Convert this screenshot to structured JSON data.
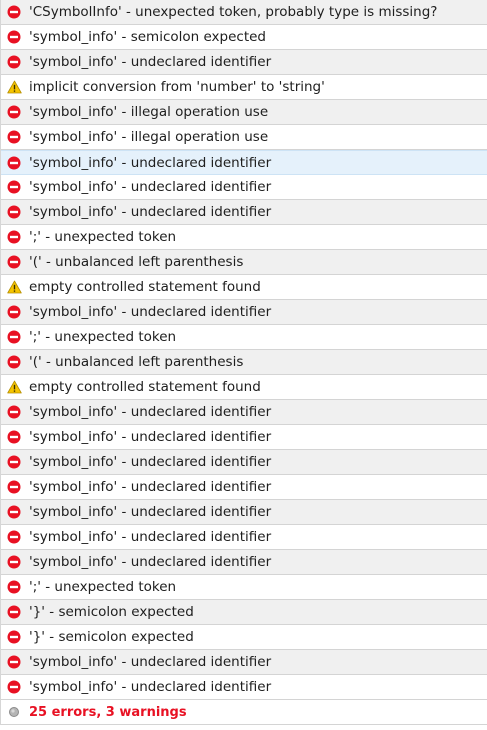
{
  "messages": [
    {
      "type": "error",
      "icon": "error-icon",
      "text": "'CSymbolInfo' - unexpected token, probably type is missing?"
    },
    {
      "type": "error",
      "icon": "error-icon",
      "text": "'symbol_info' - semicolon expected"
    },
    {
      "type": "error",
      "icon": "error-icon",
      "text": "'symbol_info' - undeclared identifier"
    },
    {
      "type": "warning",
      "icon": "warning-icon",
      "text": "implicit conversion from 'number' to 'string'"
    },
    {
      "type": "error",
      "icon": "error-icon",
      "text": "'symbol_info' - illegal operation use"
    },
    {
      "type": "error",
      "icon": "error-icon",
      "text": "'symbol_info' - illegal operation use"
    },
    {
      "type": "error",
      "icon": "error-icon",
      "text": "'symbol_info' - undeclared identifier",
      "selected": true
    },
    {
      "type": "error",
      "icon": "error-icon",
      "text": "'symbol_info' - undeclared identifier"
    },
    {
      "type": "error",
      "icon": "error-icon",
      "text": "'symbol_info' - undeclared identifier"
    },
    {
      "type": "error",
      "icon": "error-icon",
      "text": "';' - unexpected token"
    },
    {
      "type": "error",
      "icon": "error-icon",
      "text": "'(' - unbalanced left parenthesis"
    },
    {
      "type": "warning",
      "icon": "warning-icon",
      "text": "empty controlled statement found"
    },
    {
      "type": "error",
      "icon": "error-icon",
      "text": "'symbol_info' - undeclared identifier"
    },
    {
      "type": "error",
      "icon": "error-icon",
      "text": "';' - unexpected token"
    },
    {
      "type": "error",
      "icon": "error-icon",
      "text": "'(' - unbalanced left parenthesis"
    },
    {
      "type": "warning",
      "icon": "warning-icon",
      "text": "empty controlled statement found"
    },
    {
      "type": "error",
      "icon": "error-icon",
      "text": "'symbol_info' - undeclared identifier"
    },
    {
      "type": "error",
      "icon": "error-icon",
      "text": "'symbol_info' - undeclared identifier"
    },
    {
      "type": "error",
      "icon": "error-icon",
      "text": "'symbol_info' - undeclared identifier"
    },
    {
      "type": "error",
      "icon": "error-icon",
      "text": "'symbol_info' - undeclared identifier"
    },
    {
      "type": "error",
      "icon": "error-icon",
      "text": "'symbol_info' - undeclared identifier"
    },
    {
      "type": "error",
      "icon": "error-icon",
      "text": "'symbol_info' - undeclared identifier"
    },
    {
      "type": "error",
      "icon": "error-icon",
      "text": "'symbol_info' - undeclared identifier"
    },
    {
      "type": "error",
      "icon": "error-icon",
      "text": "';' - unexpected token"
    },
    {
      "type": "error",
      "icon": "error-icon",
      "text": "'}' - semicolon expected"
    },
    {
      "type": "error",
      "icon": "error-icon",
      "text": "'}' - semicolon expected"
    },
    {
      "type": "error",
      "icon": "error-icon",
      "text": "'symbol_info' - undeclared identifier"
    },
    {
      "type": "error",
      "icon": "error-icon",
      "text": "'symbol_info' - undeclared identifier"
    }
  ],
  "summary": {
    "icon": "status-dot-icon",
    "text": "25 errors, 3 warnings"
  },
  "colors": {
    "error_red": "#e81123",
    "warning_yellow": "#f5c400",
    "selected_row": "#e5f1fb",
    "alt_row": "#f0f0f0"
  }
}
